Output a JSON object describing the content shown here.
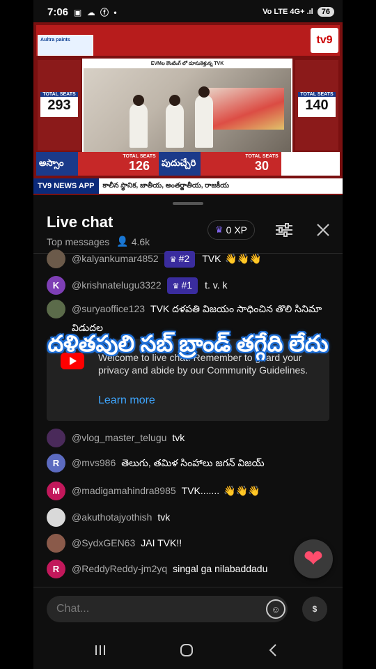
{
  "status_bar": {
    "time": "7:06",
    "left_icons": "▣ ☁ ⓕ •",
    "signal_text": "Vo LTE 4G+ .ıl",
    "battery": "76"
  },
  "video": {
    "ad_text": "Aultra paints",
    "channel_logo": "tv9",
    "frame_caption": "EVMల కౌంటింగ్ లో దూసుకెళ్తున్న TVK",
    "left_seats_label": "TOTAL SEATS",
    "left_seats_value": "293",
    "right_seats_label": "TOTAL SEATS",
    "right_seats_value": "140",
    "bottom_left_name": "అస్సాం",
    "bottom_left_total_label": "TOTAL SEATS",
    "bottom_left_total": "126",
    "bottom_right_name": "పుదుచ్చేరి",
    "bottom_right_total_label": "TOTAL SEATS",
    "bottom_right_total": "30",
    "ticker_app": "TV9 NEWS APP",
    "ticker_text": "కాలీన స్థానిక, జాతీయ, అంతర్జాతీయ, రాజకీయ"
  },
  "chat_header": {
    "title": "Live chat",
    "subtitle": "Top messages",
    "viewers": "4.6k",
    "xp": "0 XP"
  },
  "messages": [
    {
      "avatar": "",
      "avatar_color": "#6b5a4a",
      "username": "@kalyankumar4852",
      "badge": "#2",
      "text": "TVK",
      "claps": "👋👋👋"
    },
    {
      "avatar": "K",
      "avatar_color": "#7e3fb5",
      "username": "@krishnatelugu3322",
      "badge": "#1",
      "text": "t. v. k",
      "claps": ""
    },
    {
      "avatar": "",
      "avatar_color": "#5b6b4a",
      "username": "@suryaoffice123",
      "badge": "",
      "text": "TVK దళపతి విజయం సాధించిన తొలి సినిమా విడుదల",
      "claps": ""
    },
    {
      "avatar": "",
      "avatar_color": "#4a2a5a",
      "username": "@vlog_master_telugu",
      "badge": "",
      "text": "tvk",
      "claps": ""
    },
    {
      "avatar": "R",
      "avatar_color": "#5c6bc0",
      "username": "@mvs986",
      "badge": "",
      "text": "తెలుగు, తమిళ సింహాలు జగన్ విజయ్",
      "claps": ""
    },
    {
      "avatar": "M",
      "avatar_color": "#c2185b",
      "username": "@madigamahindra8985",
      "badge": "",
      "text": "TVK.......",
      "claps": "👋👋👋"
    },
    {
      "avatar": "",
      "avatar_color": "#d9d9d9",
      "username": "@akuthotajyothish",
      "badge": "",
      "text": "tvk",
      "claps": ""
    },
    {
      "avatar": "",
      "avatar_color": "#8a5a4a",
      "username": "@SydxGEN63",
      "badge": "",
      "text": "JAI TVK!!",
      "claps": ""
    },
    {
      "avatar": "R",
      "avatar_color": "#c2185b",
      "username": "@ReddyReddy-jm2yq",
      "badge": "",
      "text": "singal ga nilabaddadu",
      "claps": ""
    }
  ],
  "welcome": {
    "text": "Welcome to live chat! Remember to guard your privacy and abide by our Community Guidelines.",
    "learn_more": "Learn more"
  },
  "overlay_caption": "దళితపులి సబ్ బ్రాండ్ తగ్గేది లేదు",
  "input": {
    "placeholder": "Chat..."
  },
  "super_chat_label": "$",
  "colors": {
    "background": "#0f0f0f",
    "badge": "#3a2c9e",
    "link": "#3ea6ff",
    "heart": "#ff4d6d"
  }
}
